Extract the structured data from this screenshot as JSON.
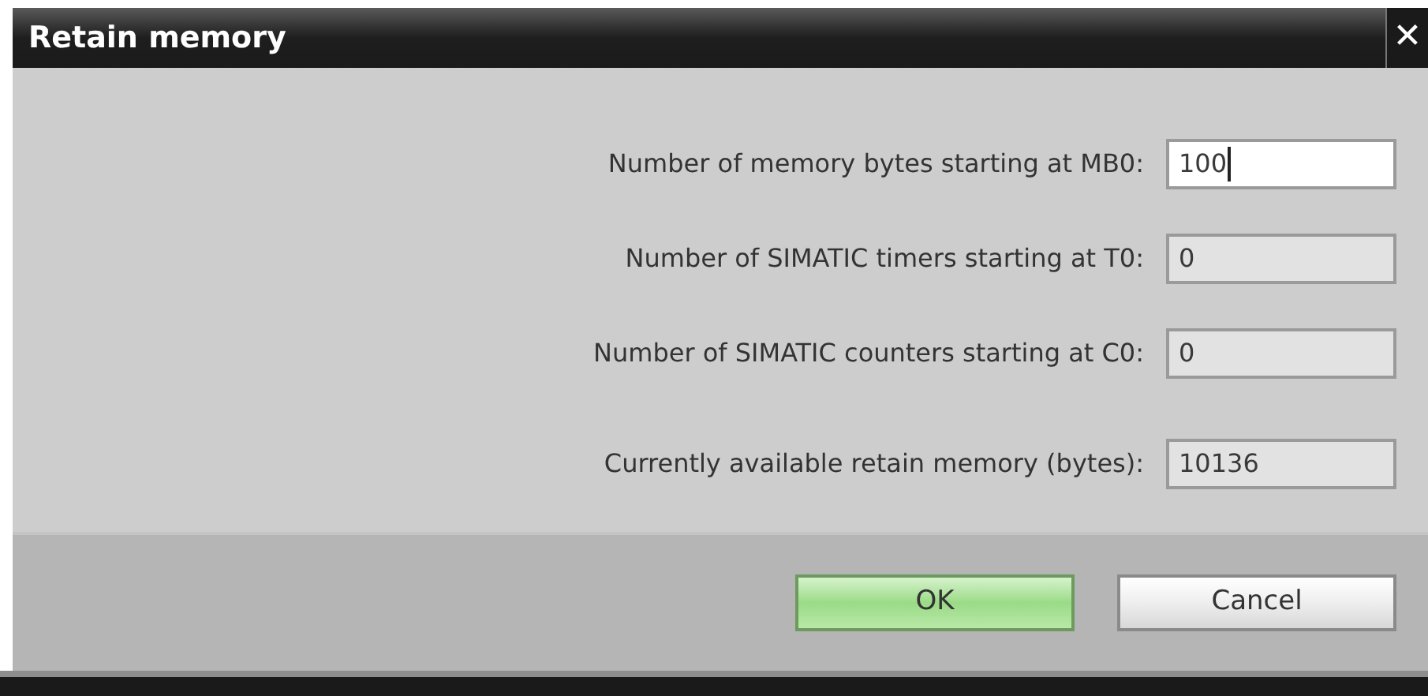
{
  "window": {
    "title": "Retain memory",
    "close": "✕"
  },
  "fields": [
    {
      "label": "Number of memory bytes starting at MB0:",
      "value": "100",
      "disabled": false,
      "focused": true
    },
    {
      "label": "Number of SIMATIC timers starting at T0:",
      "value": "0",
      "disabled": true,
      "focused": false
    },
    {
      "label": "Number of SIMATIC counters starting at C0:",
      "value": "0",
      "disabled": true,
      "focused": false
    },
    {
      "label": "Currently available retain memory (bytes):",
      "value": "10136",
      "disabled": true,
      "focused": false
    }
  ],
  "buttons": [
    {
      "label": "OK",
      "default": true
    },
    {
      "label": "Cancel",
      "default": false
    }
  ]
}
